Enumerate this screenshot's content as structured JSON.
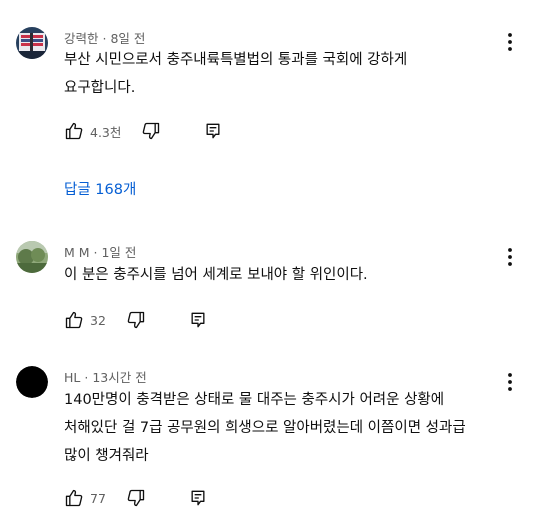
{
  "comments": [
    {
      "author": "강력한",
      "time": "8일 전",
      "text_lines": [
        "부산 시민으로서 충주내륙특별법의 통과를 국회에 강하게",
        "요구합니다."
      ],
      "likes": "4.3천",
      "avatar": "flag-image-avatar",
      "replies_label": "답글 168개"
    },
    {
      "author": "M M",
      "time": "1일 전",
      "text_lines": [
        "이 분은 충주시를 넘어 세계로 보내야 할 위인이다."
      ],
      "likes": "32",
      "avatar": "landscape-image-avatar"
    },
    {
      "author": "HL",
      "time": "13시간 전",
      "text_lines": [
        "140만명이 충격받은 상태로 물 대주는 충주시가 어려운 상황에",
        "처해있단 걸 7급 공무원의 희생으로 알아버렸는데 이쯤이면 성과급",
        "많이 챙겨줘라"
      ],
      "likes": "77",
      "avatar": "black-circle-avatar"
    }
  ],
  "colors": {
    "text": "#0f0f0f",
    "secondary": "#606060",
    "link": "#065fd4"
  },
  "icons": [
    "thumb-up-icon",
    "thumb-down-icon",
    "reply-icon",
    "more-vert-icon"
  ]
}
